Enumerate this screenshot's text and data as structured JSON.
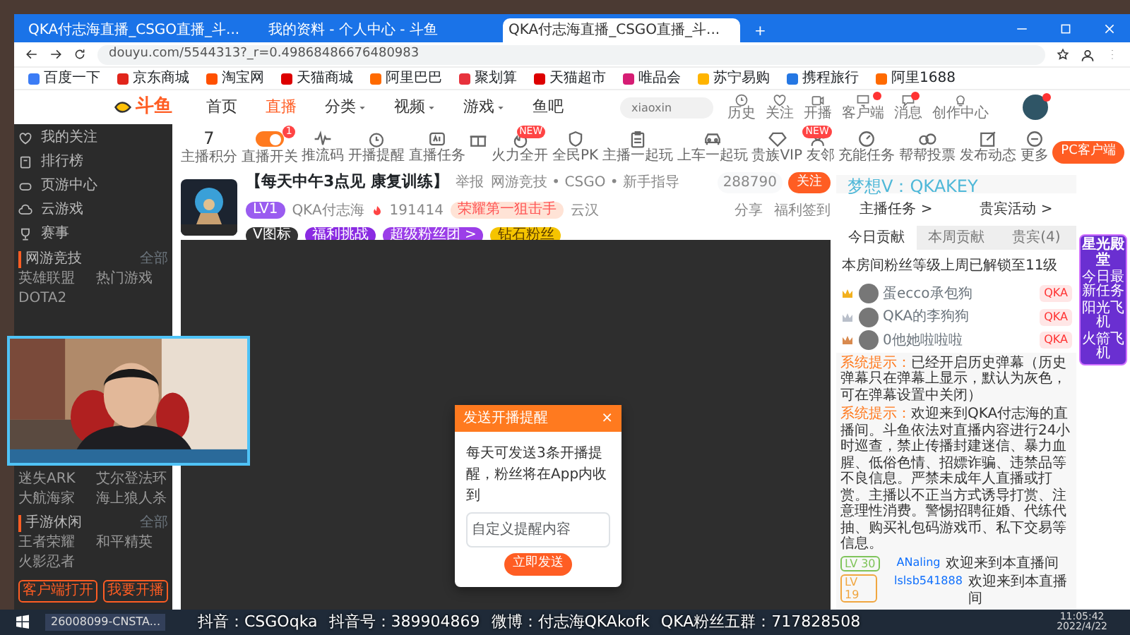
{
  "browser": {
    "tabs": [
      {
        "title": "QKA付志海直播_CSGO直播_斗...",
        "selected": false
      },
      {
        "title": "我的资料 - 个人中心 - 斗鱼",
        "selected": false
      },
      {
        "title": "QKA付志海直播_CSGO直播_斗...",
        "selected": true
      }
    ],
    "new_tab": "+",
    "url": "douyu.com/5544313?_r=0.49868486676480983",
    "bookmarks": [
      "百度一下",
      "京东商城",
      "淘宝网",
      "天猫商城",
      "阿里巴巴",
      "聚划算",
      "天猫超市",
      "唯品会",
      "苏宁易购",
      "携程旅行",
      "阿里1688"
    ]
  },
  "site": {
    "logo": "斗鱼",
    "nav": [
      {
        "label": "首页",
        "selected": false,
        "dropdown": false
      },
      {
        "label": "直播",
        "selected": true,
        "dropdown": false
      },
      {
        "label": "分类",
        "selected": false,
        "dropdown": true
      },
      {
        "label": "视频",
        "selected": false,
        "dropdown": true
      },
      {
        "label": "游戏",
        "selected": false,
        "dropdown": true
      },
      {
        "label": "鱼吧",
        "selected": false,
        "dropdown": false
      }
    ],
    "search": {
      "placeholder": "xiaoxin"
    },
    "header_icons": [
      {
        "label": "历史",
        "dot": false
      },
      {
        "label": "关注",
        "dot": false
      },
      {
        "label": "开播",
        "dot": false
      },
      {
        "label": "客户端",
        "dot": true
      },
      {
        "label": "消息",
        "dot": true
      },
      {
        "label": "创作中心",
        "dot": false
      }
    ],
    "avatar": {
      "dot": true
    }
  },
  "sidebar": {
    "items": [
      {
        "label": "我的关注"
      },
      {
        "label": "排行榜"
      },
      {
        "label": "页游中心"
      },
      {
        "label": "云游戏"
      },
      {
        "label": "赛事"
      }
    ],
    "sections": [
      {
        "title": "网游竞技",
        "more": "全部",
        "games_top": [
          "英雄联盟",
          "热门游戏",
          "DOTA2"
        ],
        "games_bottom": [
          "迷失ARK",
          "艾尔登法环",
          "大航海家",
          "海上狼人杀"
        ]
      },
      {
        "title": "手游休闲",
        "more": "全部",
        "games_top": [
          "王者荣耀",
          "和平精英",
          "火影忍者"
        ]
      }
    ],
    "buttons": [
      "客户端打开",
      "我要开播"
    ]
  },
  "toolbar": {
    "items": [
      {
        "kind": "score",
        "value": "7",
        "label": "主播积分"
      },
      {
        "kind": "toggle",
        "on": true,
        "label": "直播开关",
        "badge": "1"
      },
      {
        "kind": "icon",
        "label": "推流码"
      },
      {
        "kind": "icon",
        "label": "开播提醒"
      },
      {
        "kind": "icon",
        "label": "直播任务"
      },
      {
        "kind": "icon"
      },
      {
        "kind": "icon",
        "label": "火力全开",
        "badge": "NEW"
      },
      {
        "kind": "icon",
        "label": "全民PK"
      },
      {
        "kind": "icon",
        "label": "主播一起玩"
      },
      {
        "kind": "icon",
        "label": "上车一起玩"
      },
      {
        "kind": "icon",
        "label": "贵族VIP"
      },
      {
        "kind": "icon",
        "label": "友邻",
        "badge": "NEW"
      },
      {
        "kind": "icon",
        "label": "充能任务"
      },
      {
        "kind": "icon",
        "label": "帮帮投票"
      },
      {
        "kind": "icon",
        "label": "发布动态"
      },
      {
        "kind": "icon",
        "label": "更多"
      }
    ],
    "client_button": "PC客户端"
  },
  "room": {
    "title": "【每天中午3点见 康复训练】",
    "report": "举报",
    "category": "网游竞技 • CSGO • 新手指导",
    "level": "LV1",
    "streamer": "QKA付志海",
    "heat": "191414",
    "honor": "荣耀第一狙击手",
    "location": "云汉",
    "chips": [
      "V图标",
      "福利挑战",
      "超级粉丝团 >",
      "钻石粉丝"
    ],
    "follow_count": "288790",
    "follow": "关注",
    "share": "分享",
    "signin": "福利签到"
  },
  "dialog": {
    "title": "发送开播提醒",
    "close": "×",
    "text": "每天可发送3条开播提醒，粉丝将在App内收到",
    "placeholder": "自定义提醒内容",
    "button": "立即发送"
  },
  "panel": {
    "links": [
      "主播任务 >",
      "贵宾活动 >"
    ],
    "tabs": [
      {
        "label": "今日贡献",
        "selected": true
      },
      {
        "label": "本周贡献",
        "selected": false
      },
      {
        "label": "贵宾(4)",
        "selected": false
      }
    ],
    "unlock": "本房间粉丝等级上周已解锁至11级",
    "fans": [
      {
        "name": "蛋ecco承包狗",
        "tag": "QKA",
        "color": "#f2b01e"
      },
      {
        "name": "QKA的李狗狗",
        "tag": "QKA",
        "color": "#b9bfca"
      },
      {
        "name": "0他她啦啦啦",
        "tag": "QKA",
        "color": "#d98a4f"
      }
    ],
    "chat": [
      {
        "kind": "system",
        "label": "系统提示：",
        "text": "已经开启历史弹幕（历史弹幕只在弹幕上显示，默认为灰色，可在弹幕设置中关闭）"
      },
      {
        "kind": "system",
        "label": "系统提示：",
        "text": "欢迎来到QKA付志海的直播间。斗鱼依法对直播内容进行24小时巡查，禁止传播封建迷信、暴力血腥、低俗色情、招嫖诈骗、违禁品等不良信息。严禁未成年人直播或打赏。主播以不正当方式诱导打赏、注意理性消费。警惕招聘征婚、代练代抽、购买礼包码游戏币、私下交易等信息。"
      },
      {
        "kind": "enter",
        "level": "LV 30",
        "user": "ANaling",
        "text": "欢迎来到本直播间",
        "color": "#7fc45a"
      },
      {
        "kind": "enter",
        "level": "LV 19",
        "user": "lslsb541888",
        "text": "欢迎来到本直播间",
        "color": "#f0a640"
      }
    ]
  },
  "overlay": {
    "watermark": "梦想V：QKAKEY",
    "promo": {
      "title": "星光殿堂",
      "task": "今日最新任务",
      "rewards": [
        "阳光飞机",
        "火箭飞机"
      ]
    },
    "socials": [
      "抖音：CSGOqka",
      "抖音号：389904869",
      "微博：付志海QKAkofk",
      "QKA粉丝五群：717828508"
    ]
  },
  "taskbar": {
    "task": "26008099-CNSTA...",
    "time": "11:05:42",
    "date": "2022/4/22"
  }
}
